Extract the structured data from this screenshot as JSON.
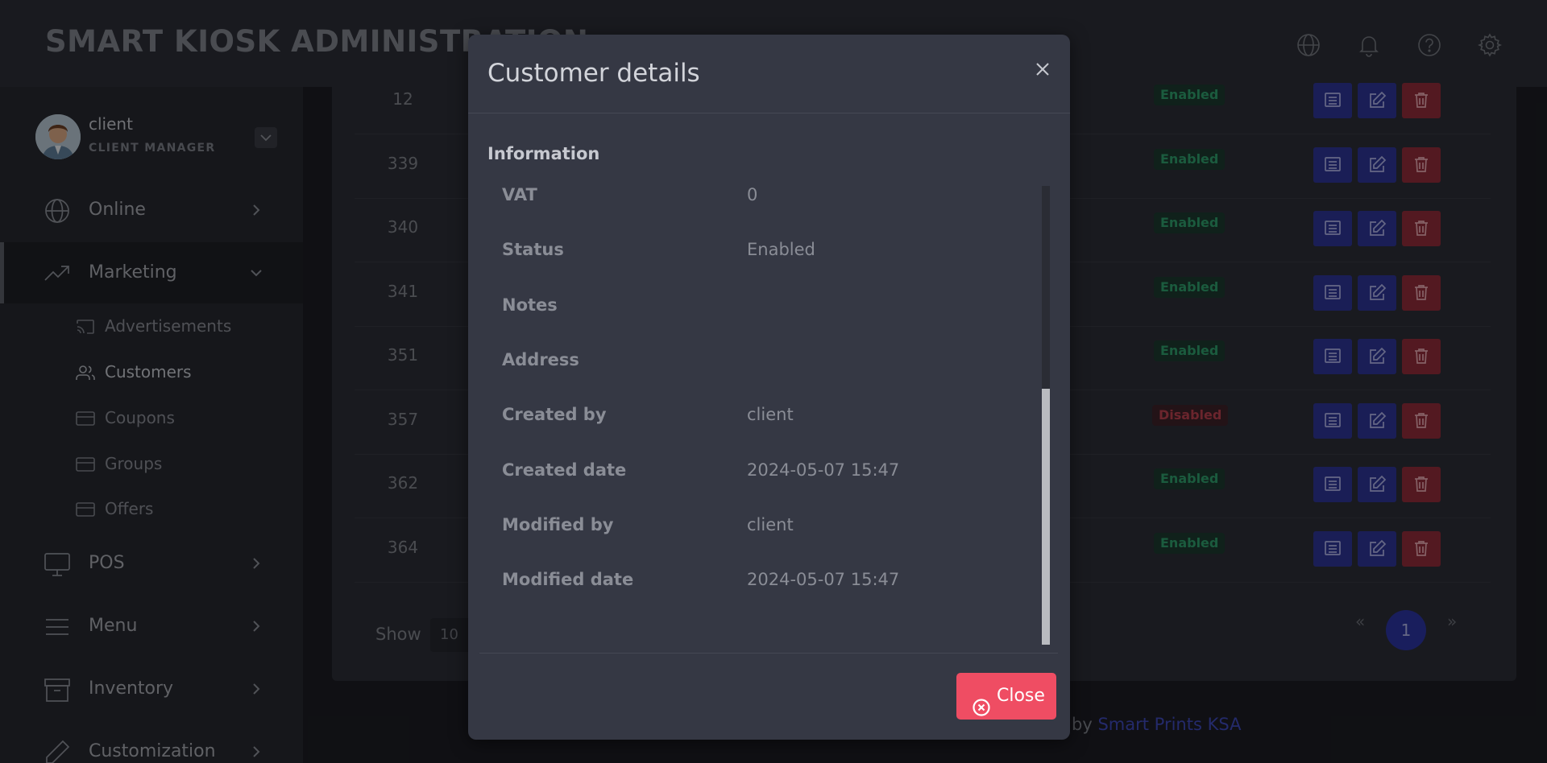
{
  "app": {
    "title": "SMART KIOSK ADMINISTRATION"
  },
  "topbar": {
    "icons": [
      "globe-icon",
      "bell-icon",
      "help-circle-icon",
      "gear-icon"
    ]
  },
  "user": {
    "name": "client",
    "role": "CLIENT MANAGER"
  },
  "sidebar": {
    "items": [
      {
        "label": "Online",
        "icon": "globe-icon"
      },
      {
        "label": "Marketing",
        "icon": "trending-up-icon"
      },
      {
        "label": "POS",
        "icon": "monitor-icon"
      },
      {
        "label": "Menu",
        "icon": "menu-icon"
      },
      {
        "label": "Inventory",
        "icon": "archive-icon"
      },
      {
        "label": "Customization",
        "icon": "pen-icon"
      }
    ],
    "marketing_sub": [
      {
        "label": "Advertisements",
        "icon": "cast-icon"
      },
      {
        "label": "Customers",
        "icon": "users-icon"
      },
      {
        "label": "Coupons",
        "icon": "card-icon"
      },
      {
        "label": "Groups",
        "icon": "card-icon"
      },
      {
        "label": "Offers",
        "icon": "card-icon"
      }
    ]
  },
  "table": {
    "rows": [
      {
        "id": "12",
        "status": "Enabled"
      },
      {
        "id": "339",
        "status": "Enabled"
      },
      {
        "id": "340",
        "status": "Enabled"
      },
      {
        "id": "341",
        "status": "Enabled"
      },
      {
        "id": "351",
        "status": "Enabled"
      },
      {
        "id": "357",
        "status": "Disabled"
      },
      {
        "id": "362",
        "status": "Enabled"
      },
      {
        "id": "364",
        "status": "Enabled"
      }
    ],
    "show_label": "Show",
    "page_size": "10",
    "pagination": {
      "prev": "«",
      "current": "1",
      "next": "»"
    }
  },
  "footer": {
    "text": "by",
    "link": "Smart Prints KSA"
  },
  "modal": {
    "title": "Customer details",
    "section": "Information",
    "fields": [
      {
        "label": "VAT",
        "value": "0"
      },
      {
        "label": "Status",
        "value": "Enabled"
      },
      {
        "label": "Notes",
        "value": ""
      },
      {
        "label": "Address",
        "value": ""
      },
      {
        "label": "Created by",
        "value": "client"
      },
      {
        "label": "Created date",
        "value": "2024-05-07 15:47"
      },
      {
        "label": "Modified by",
        "value": "client"
      },
      {
        "label": "Modified date",
        "value": "2024-05-07 15:47"
      }
    ],
    "close_label": "Close"
  },
  "colors": {
    "accent": "#2c35a0",
    "danger": "#ef4d63",
    "enabled": "#2f9e6b",
    "disabled": "#b8404f"
  }
}
